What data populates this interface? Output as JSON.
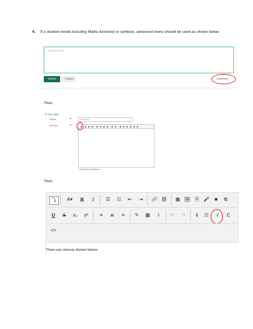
{
  "step": {
    "number": "4.",
    "text": "If a student needs including Maths functions or symbols, advanced menu should be used as shown below"
  },
  "shot1": {
    "placeholder": "Write your reply...",
    "submit_label": "Submit",
    "cancel_label": "Cancel",
    "advanced_label": "Advanced"
  },
  "then1": "Then",
  "shot2": {
    "heading": "Your reply",
    "subject_label": "Subject",
    "subject_value": "Re: Subject",
    "message_label": "Message",
    "attachment_label": "Discussion subscription"
  },
  "then2": "Then",
  "shot3": {
    "row1": [
      "⤵",
      "A▾",
      "B",
      "I",
      "☰",
      "☷",
      "⇤",
      "⇥",
      "🔗",
      "⛓",
      "▦",
      "🖼",
      "🗎",
      "🎤",
      "■",
      "⧉"
    ],
    "row2": [
      "U",
      "S",
      "x₂",
      "x²",
      "≡",
      "≣",
      "≡",
      "✎",
      "▦",
      "I",
      "↶",
      "↷",
      "ℹ",
      "☷",
      "√",
      "C"
    ],
    "row3": [
      "</>"
    ]
  },
  "then3": "Then use menus shown below",
  "colors": {
    "accent": "#1a6e4a",
    "annotation": "#e0262b"
  }
}
